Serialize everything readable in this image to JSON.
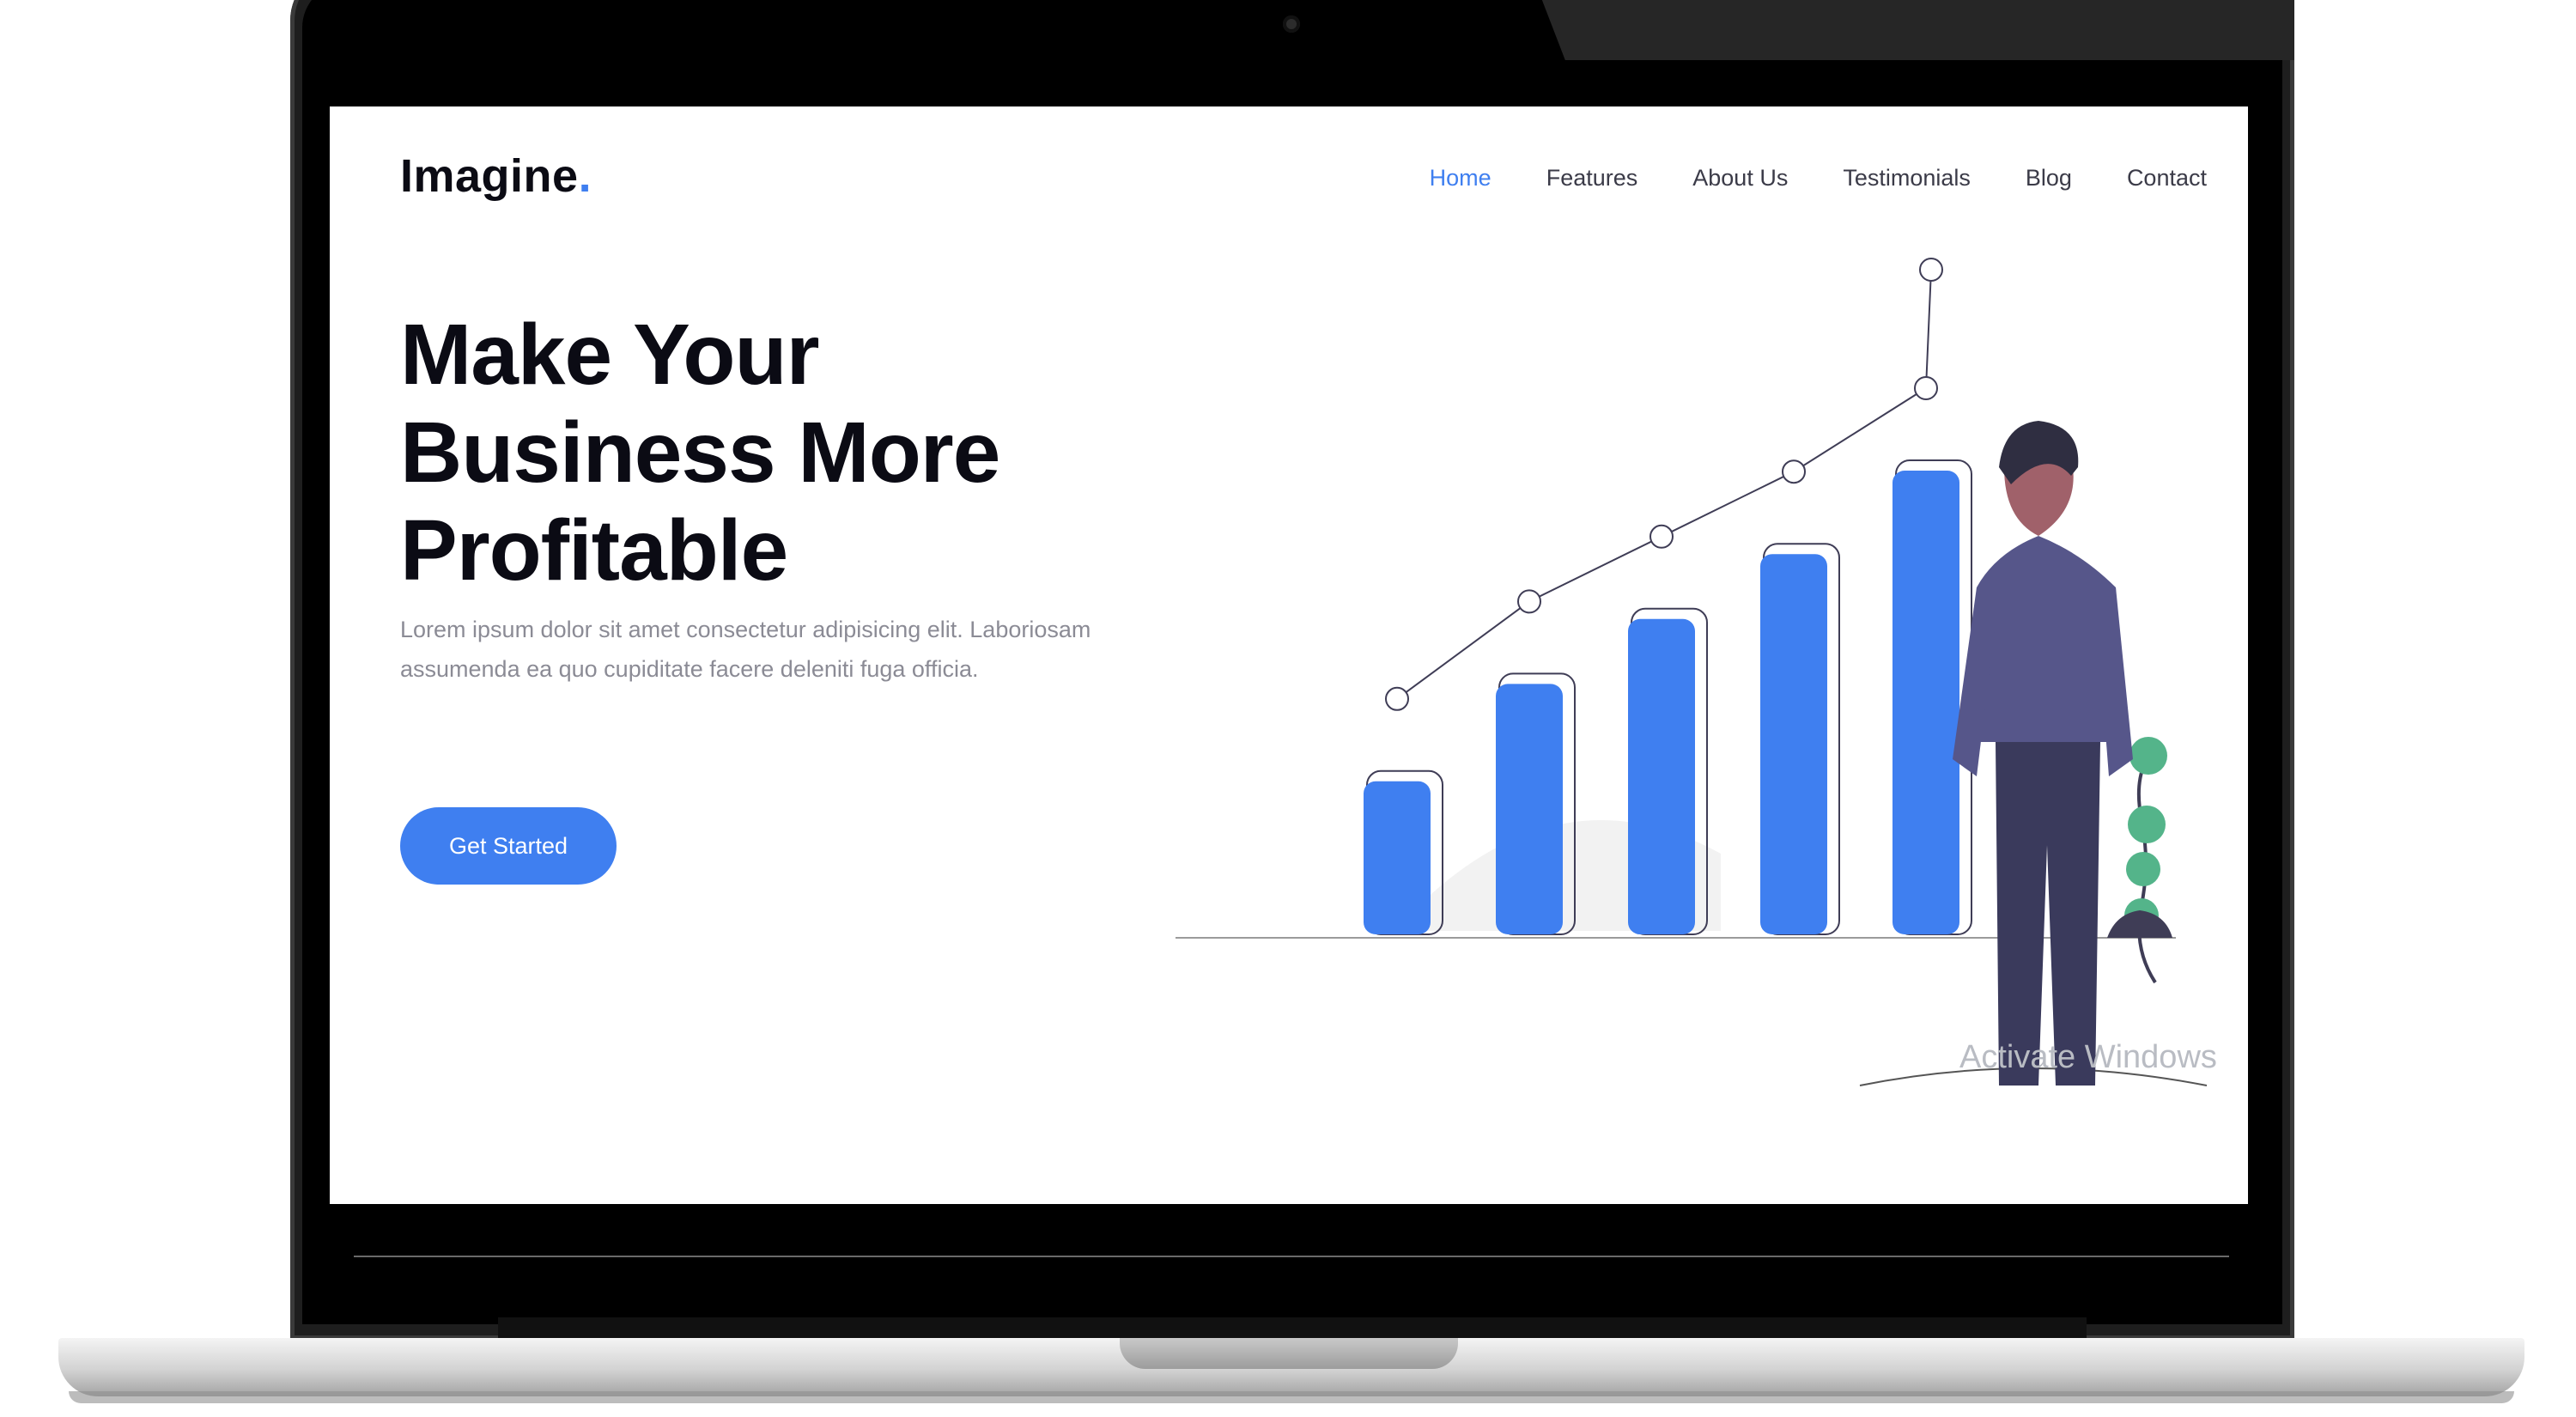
{
  "brand": {
    "name": "Imagine",
    "accent_dot": ".",
    "accent_color": "#3f7ff0"
  },
  "nav": {
    "items": [
      {
        "label": "Home",
        "active": true
      },
      {
        "label": "Features",
        "active": false
      },
      {
        "label": "About Us",
        "active": false
      },
      {
        "label": "Testimonials",
        "active": false
      },
      {
        "label": "Blog",
        "active": false
      },
      {
        "label": "Contact",
        "active": false
      }
    ]
  },
  "hero": {
    "title_lines": [
      "Make Your",
      "Business More",
      "Profitable"
    ],
    "description": "Lorem ipsum dolor sit amet consectetur adipisicing elit. Laboriosam assumenda ea quo cupiditate facere deleniti fuga officia.",
    "cta_label": "Get Started"
  },
  "illustration": {
    "bar_color": "#3f7ff0",
    "bars": [
      0.33,
      0.54,
      0.68,
      0.82,
      1.0
    ],
    "person": {
      "jacket": "#56568a",
      "pants": "#3a3a5c",
      "hair": "#2f2e41"
    },
    "plant_color": "#54b48a"
  },
  "system": {
    "watermark": "Activate Windows"
  }
}
